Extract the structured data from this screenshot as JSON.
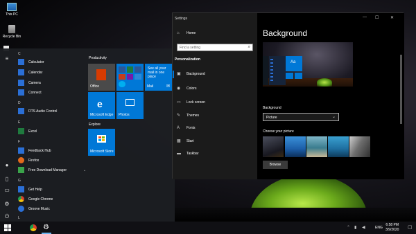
{
  "desktop": {
    "icons": [
      {
        "label": "This PC"
      },
      {
        "label": "Recycle Bin"
      }
    ]
  },
  "start_menu": {
    "apps": [
      {
        "letter": "C"
      },
      {
        "label": "Calculator",
        "color": "#2b6fd6"
      },
      {
        "label": "Calendar",
        "color": "#2b6fd6"
      },
      {
        "label": "Camera",
        "color": "#2b6fd6"
      },
      {
        "label": "Connect",
        "color": "#2b6fd6"
      },
      {
        "letter": "D"
      },
      {
        "label": "DTS Audio Control",
        "color": "#2b6fd6"
      },
      {
        "letter": "E"
      },
      {
        "label": "Excel",
        "color": "#1f7a3e"
      },
      {
        "letter": "F"
      },
      {
        "label": "Feedback Hub",
        "color": "#2b6fd6"
      },
      {
        "label": "Firefox",
        "color": "#e46a1c"
      },
      {
        "label": "Free Download Manager",
        "color": "#3aa34a"
      },
      {
        "letter": "G"
      },
      {
        "label": "Get Help",
        "color": "#2b6fd6"
      },
      {
        "label": "Google Chrome",
        "color": "#d9412c"
      },
      {
        "label": "Groove Music",
        "color": "#2b6fd6"
      },
      {
        "letter": "L"
      }
    ],
    "groups": {
      "productivity": "Productivity",
      "explore": "Explore"
    },
    "tiles": {
      "office": "Office",
      "mail_text": "See all your mail in one place",
      "mail": "Mail",
      "edge": "Microsoft Edge",
      "photos": "Photos",
      "store": "Microsoft Store"
    },
    "colors": {
      "accent": "#0078d7",
      "office": "#4a4a4a"
    }
  },
  "settings": {
    "title": "Settings",
    "home": "Home",
    "search_placeholder": "Find a setting",
    "section": "Personalization",
    "nav": [
      {
        "label": "Background",
        "icon": "image-icon"
      },
      {
        "label": "Colors",
        "icon": "palette-icon"
      },
      {
        "label": "Lock screen",
        "icon": "lock-screen-icon"
      },
      {
        "label": "Themes",
        "icon": "brush-icon"
      },
      {
        "label": "Fonts",
        "icon": "font-icon"
      },
      {
        "label": "Start",
        "icon": "start-icon"
      },
      {
        "label": "Taskbar",
        "icon": "taskbar-icon"
      }
    ],
    "page_title": "Background",
    "preview_tile": "Aa",
    "background_label": "Background",
    "background_value": "Picture",
    "choose_label": "Choose your picture",
    "browse": "Browse",
    "window_controls": {
      "min": "—",
      "max": "☐",
      "close": "✕"
    }
  },
  "taskbar": {
    "tray_lang": "ENG",
    "time": "6:58 PM",
    "date": "3/9/2020"
  }
}
